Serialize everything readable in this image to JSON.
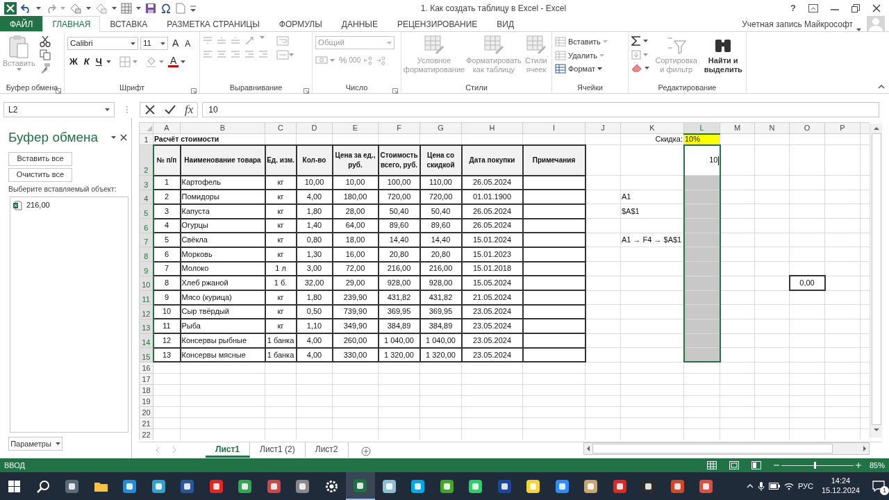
{
  "title_bar": {
    "title": "1. Как создать таблицу в Excel - Excel",
    "help": "?"
  },
  "ribbon_tabs": [
    {
      "label": "ФАЙЛ",
      "kind": "file",
      "selected": false
    },
    {
      "label": "ГЛАВНАЯ",
      "kind": "tab",
      "selected": true
    },
    {
      "label": "ВСТАВКА",
      "kind": "tab",
      "selected": false
    },
    {
      "label": "РАЗМЕТКА СТРАНИЦЫ",
      "kind": "tab",
      "selected": false
    },
    {
      "label": "ФОРМУЛЫ",
      "kind": "tab",
      "selected": false
    },
    {
      "label": "ДАННЫЕ",
      "kind": "tab",
      "selected": false
    },
    {
      "label": "РЕЦЕНЗИРОВАНИЕ",
      "kind": "tab",
      "selected": false
    },
    {
      "label": "ВИД",
      "kind": "tab",
      "selected": false
    }
  ],
  "account": "Учетная запись Майкрософт",
  "ribbon": {
    "clipboard": {
      "label": "Буфер обмена",
      "paste": {
        "label": "Вставить",
        "disabled": true
      }
    },
    "font": {
      "label": "Шрифт",
      "font_name": "Calibri",
      "font_size": "11",
      "grow": "A",
      "shrink": "A",
      "bold": "Ж",
      "italic": "К",
      "underline": "Ч",
      "font_color": "A"
    },
    "alignment": {
      "label": "Выравнивание",
      "disabled": true
    },
    "number": {
      "label": "Число",
      "format": "Общий",
      "percent": "%",
      "thousands": "000",
      "disabled": true
    },
    "styles": {
      "label": "Стили",
      "buttons": [
        {
          "label": "Условное форматирование",
          "disabled": true
        },
        {
          "label": "Форматировать как таблицу",
          "disabled": true
        },
        {
          "label": "Стили ячеек",
          "disabled": true
        }
      ]
    },
    "cells": {
      "label": "Ячейки",
      "buttons": [
        {
          "label": "Вставить",
          "disabled": true
        },
        {
          "label": "Удалить",
          "disabled": true
        },
        {
          "label": "Формат",
          "disabled": false
        }
      ]
    },
    "editing": {
      "label": "Редактирование",
      "buttons": [
        {
          "label": "Сортировка и фильтр",
          "disabled": true
        },
        {
          "label": "Найти и выделить",
          "disabled": false
        }
      ]
    }
  },
  "formula_bar": {
    "name_box": "L2",
    "function_label": "fx",
    "value": "10"
  },
  "clipboard_pane": {
    "title": "Буфер обмена",
    "buttons": [
      "Вставить все",
      "Очистить все"
    ],
    "prompt": "Выберите вставляемый объект:",
    "items": [
      "216,00"
    ],
    "options_button": "Параметры"
  },
  "sheet": {
    "columns": [
      {
        "label": "A",
        "selected": false
      },
      {
        "label": "B",
        "selected": false
      },
      {
        "label": "C",
        "selected": false
      },
      {
        "label": "D",
        "selected": false
      },
      {
        "label": "E",
        "selected": false
      },
      {
        "label": "F",
        "selected": false
      },
      {
        "label": "G",
        "selected": false
      },
      {
        "label": "H",
        "selected": false
      },
      {
        "label": "I",
        "selected": false
      },
      {
        "label": "J",
        "selected": false
      },
      {
        "label": "K",
        "selected": false
      },
      {
        "label": "L",
        "selected": true
      },
      {
        "label": "M",
        "selected": false
      },
      {
        "label": "N",
        "selected": false
      },
      {
        "label": "O",
        "selected": false
      },
      {
        "label": "P",
        "selected": false
      }
    ],
    "rows": [
      {
        "label": "1",
        "selected": false,
        "cells": {
          "K": {
            "text": "Скидка:",
            "kind": "label",
            "highlighted": false,
            "boxed": false,
            "editing": false
          },
          "L": {
            "text": "10%",
            "kind": "value",
            "highlighted": true,
            "boxed": false,
            "editing": false
          }
        }
      },
      {
        "label": "2",
        "selected": true,
        "cells": {
          "L": {
            "text": "10",
            "kind": "input",
            "highlighted": false,
            "boxed": false,
            "editing": true
          }
        }
      },
      {
        "label": "3",
        "selected": true
      },
      {
        "label": "4",
        "selected": true,
        "cells": {
          "K": {
            "text": "A1",
            "kind": "note",
            "highlighted": false,
            "boxed": false,
            "editing": false
          }
        }
      },
      {
        "label": "5",
        "selected": true,
        "cells": {
          "K": {
            "text": "$A$1",
            "kind": "note",
            "highlighted": false,
            "boxed": false,
            "editing": false
          }
        }
      },
      {
        "label": "6",
        "selected": true
      },
      {
        "label": "7",
        "selected": true,
        "cells": {
          "K": {
            "text": "A1 → F4 → $A$1",
            "kind": "note",
            "highlighted": false,
            "boxed": false,
            "editing": false
          }
        }
      },
      {
        "label": "8",
        "selected": true
      },
      {
        "label": "9",
        "selected": true
      },
      {
        "label": "10",
        "selected": true,
        "cells": {
          "O": {
            "text": "0,00",
            "kind": "result",
            "highlighted": false,
            "boxed": true,
            "editing": false
          }
        }
      },
      {
        "label": "11",
        "selected": true
      },
      {
        "label": "12",
        "selected": true
      },
      {
        "label": "13",
        "selected": true
      },
      {
        "label": "14",
        "selected": true
      },
      {
        "label": "15",
        "selected": true
      },
      {
        "label": "16",
        "selected": false
      },
      {
        "label": "17",
        "selected": false
      },
      {
        "label": "18",
        "selected": false
      },
      {
        "label": "19",
        "selected": false
      },
      {
        "label": "20",
        "selected": false
      },
      {
        "label": "21",
        "selected": false
      },
      {
        "label": "22",
        "selected": false
      }
    ],
    "table": {
      "title": "Расчёт стоимости",
      "headers": [
        "№ п/п",
        "Наименование товара",
        "Ед. изм.",
        "Кол-во",
        "Цена за ед., руб.",
        "Стоимость всего, руб.",
        "Цена со скидкой",
        "Дата покупки",
        "Примечания"
      ],
      "rows": [
        [
          "1",
          "Картофель",
          "кг",
          "10,00",
          "10,00",
          "100,00",
          "110,00",
          "26.05.2024"
        ],
        [
          "2",
          "Помидоры",
          "кг",
          "4,00",
          "180,00",
          "720,00",
          "720,00",
          "01.01.1900"
        ],
        [
          "3",
          "Капуста",
          "кг",
          "1,80",
          "28,00",
          "50,40",
          "50,40",
          "26.05.2024"
        ],
        [
          "4",
          "Огурцы",
          "кг",
          "1,40",
          "64,00",
          "89,60",
          "89,60",
          "26.05.2024"
        ],
        [
          "5",
          "Свёкла",
          "кг",
          "0,80",
          "18,00",
          "14,40",
          "14,40",
          "15.01.2024"
        ],
        [
          "6",
          "Морковь",
          "кг",
          "1,30",
          "16,00",
          "20,80",
          "20,80",
          "15.01.2023"
        ],
        [
          "7",
          "Молоко",
          "1 л",
          "3,00",
          "72,00",
          "216,00",
          "216,00",
          "15.01.2018"
        ],
        [
          "8",
          "Хлеб ржаной",
          "1 б.",
          "32,00",
          "29,00",
          "928,00",
          "928,00",
          "15.05.2024"
        ],
        [
          "9",
          "Мясо (курица)",
          "кг",
          "1,80",
          "239,90",
          "431,82",
          "431,82",
          "21.05.2024"
        ],
        [
          "10",
          "Сыр твёрдый",
          "кг",
          "0,50",
          "739,90",
          "369,95",
          "369,95",
          "23.05.2024"
        ],
        [
          "11",
          "Рыба",
          "кг",
          "1,10",
          "349,90",
          "384,89",
          "384,89",
          "23.05.2024"
        ],
        [
          "12",
          "Консервы рыбные",
          "1 банка",
          "4,00",
          "260,00",
          "1 040,00",
          "1 040,00",
          "23.05.2024"
        ],
        [
          "13",
          "Консервы мясные",
          "1 банка",
          "4,00",
          "330,00",
          "1 320,00",
          "1 320,00",
          "23.05.2024"
        ]
      ]
    }
  },
  "sheet_tabs": [
    {
      "label": "Лист1",
      "selected": true
    },
    {
      "label": "Лист1 (2)",
      "selected": false
    },
    {
      "label": "Лист2",
      "selected": false
    }
  ],
  "status_bar": {
    "mode": "ВВОД",
    "zoom": "85%",
    "zoom_slider": {
      "level": 0.47
    }
  },
  "taskbar": {
    "language": "РУС",
    "time": "14:24",
    "date": "15.12.2024",
    "notifications": "1"
  }
}
